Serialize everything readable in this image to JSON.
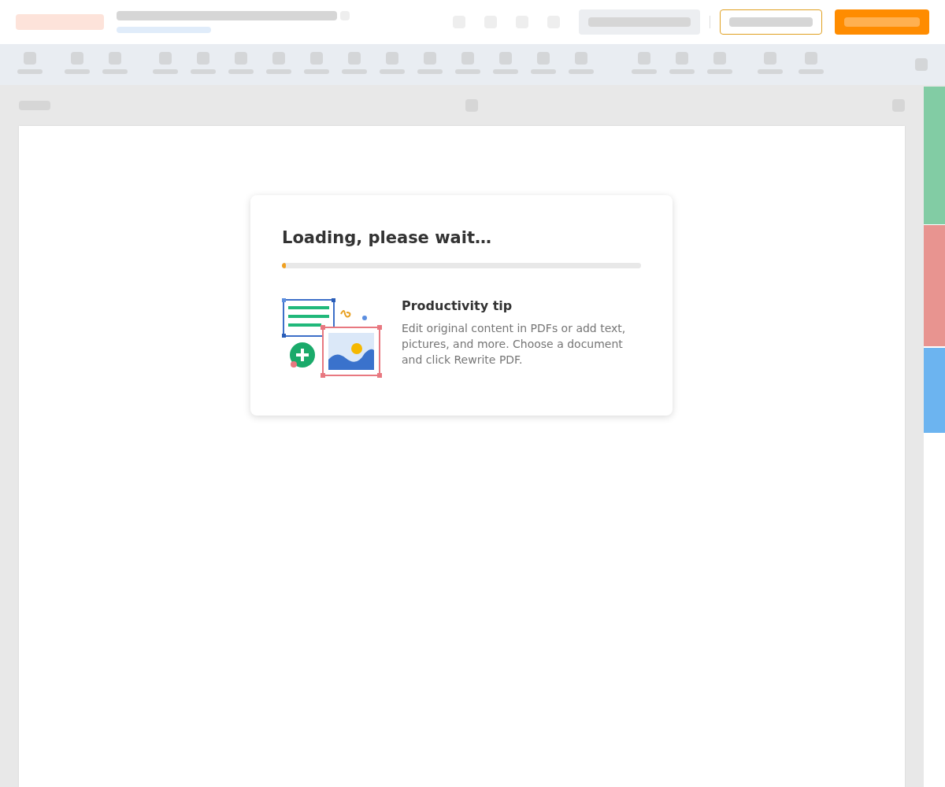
{
  "loading_dialog": {
    "title": "Loading, please wait…",
    "progress": {
      "level": 0.01
    },
    "tip": {
      "heading": "Productivity tip",
      "text": "Edit original content in PDFs or add text, pictures, and more. Choose a document and click Rewrite PDF."
    }
  }
}
